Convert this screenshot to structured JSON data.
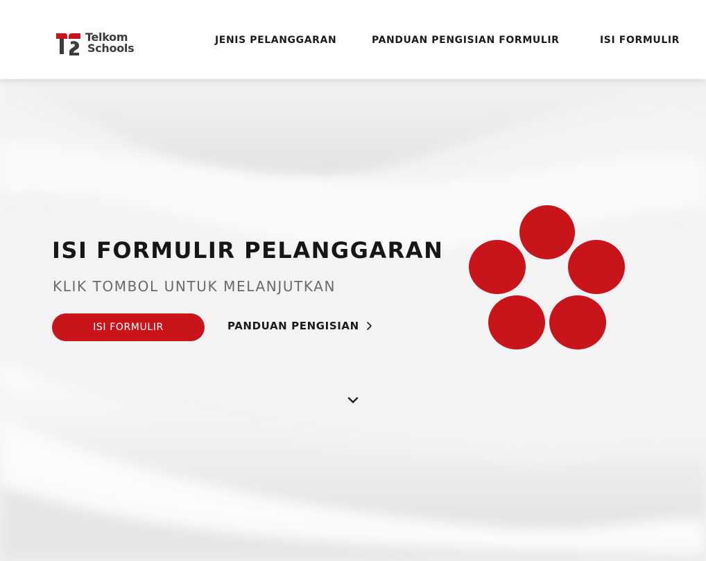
{
  "brand": {
    "name_line1": "Telkom",
    "name_line2": "Schools",
    "accent_color": "#c8141a",
    "text_color": "#3c3c3c"
  },
  "nav": {
    "items": [
      {
        "label": "JENIS PELANGGARAN"
      },
      {
        "label": "PANDUAN PENGISIAN FORMULIR"
      },
      {
        "label": "ISI FORMULIR"
      }
    ]
  },
  "hero": {
    "title": "ISI FORMULIR PELANGGARAN",
    "subtitle": "KLIK TOMBOL UNTUK MELANJUTKAN",
    "primary_button_label": "ISI FORMULIR",
    "secondary_link_label": "PANDUAN PENGISIAN",
    "secondary_link_icon": "chevron-right-icon",
    "graphic_color": "#c8141a"
  },
  "scroll": {
    "icon": "chevron-down-icon"
  }
}
